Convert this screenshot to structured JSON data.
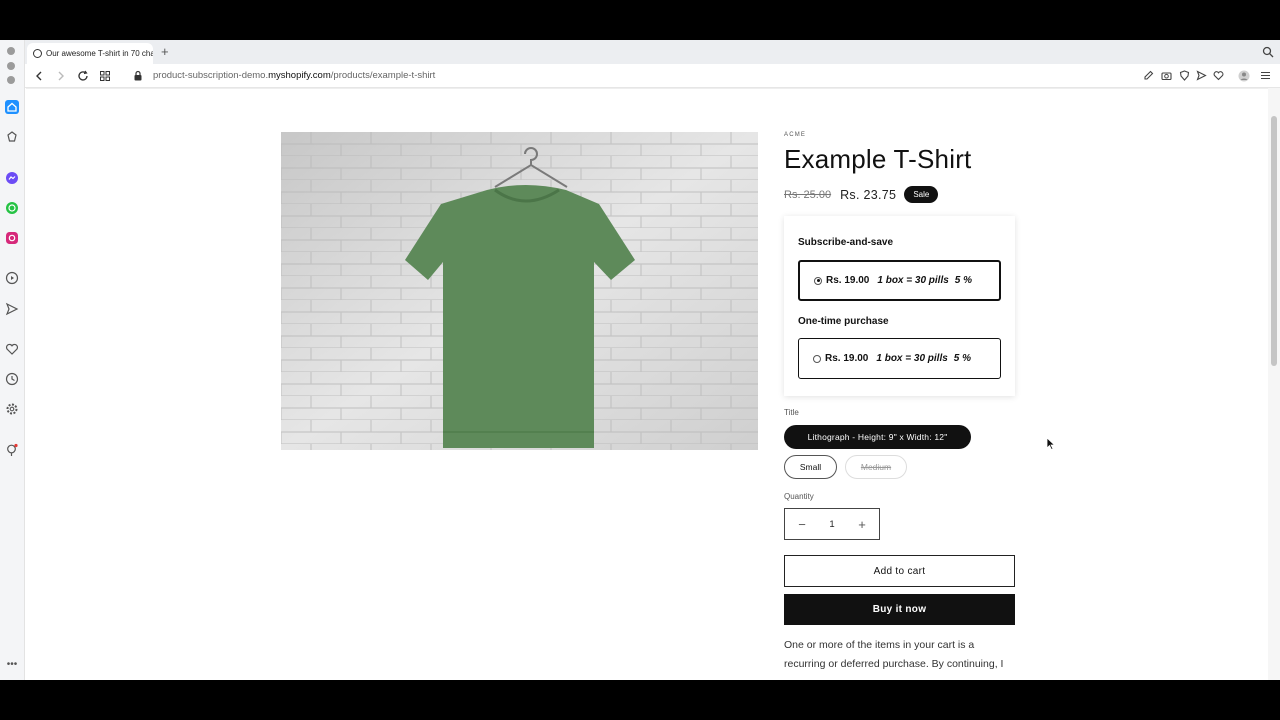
{
  "browser": {
    "tab_title": "Our awesome T-shirt in 70 cha",
    "new_tab_label": "+",
    "url_prefix": "product-subscription-demo.",
    "url_domain": "myshopify.com",
    "url_path": "/products/example-t-shirt"
  },
  "product": {
    "vendor": "ACME",
    "title": "Example T-Shirt",
    "price_regular": "Rs. 25.00",
    "price_sale": "Rs. 23.75",
    "sale_badge": "Sale",
    "image_color": "#5e8a5a"
  },
  "subscription": {
    "subscribe_title": "Subscribe-and-save",
    "subscribe_option": {
      "price": "Rs. 19.00",
      "detail": "1 box = 30 pills",
      "percent": "5 %"
    },
    "onetime_title": "One-time purchase",
    "onetime_option": {
      "price": "Rs. 19.00",
      "detail": "1 box = 30 pills",
      "percent": "5 %"
    }
  },
  "variants": {
    "label": "Title",
    "options": [
      "Lithograph - Height: 9\" x Width: 12\"",
      "Small",
      "Medium"
    ],
    "selected": "Lithograph - Height: 9\" x Width: 12\""
  },
  "quantity": {
    "label": "Quantity",
    "value": "1",
    "minus": "−",
    "plus": "+"
  },
  "actions": {
    "add_to_cart": "Add to cart",
    "buy_now": "Buy it now"
  },
  "disclaimer": "One or more of the items in your cart is a recurring or deferred purchase. By continuing, I"
}
